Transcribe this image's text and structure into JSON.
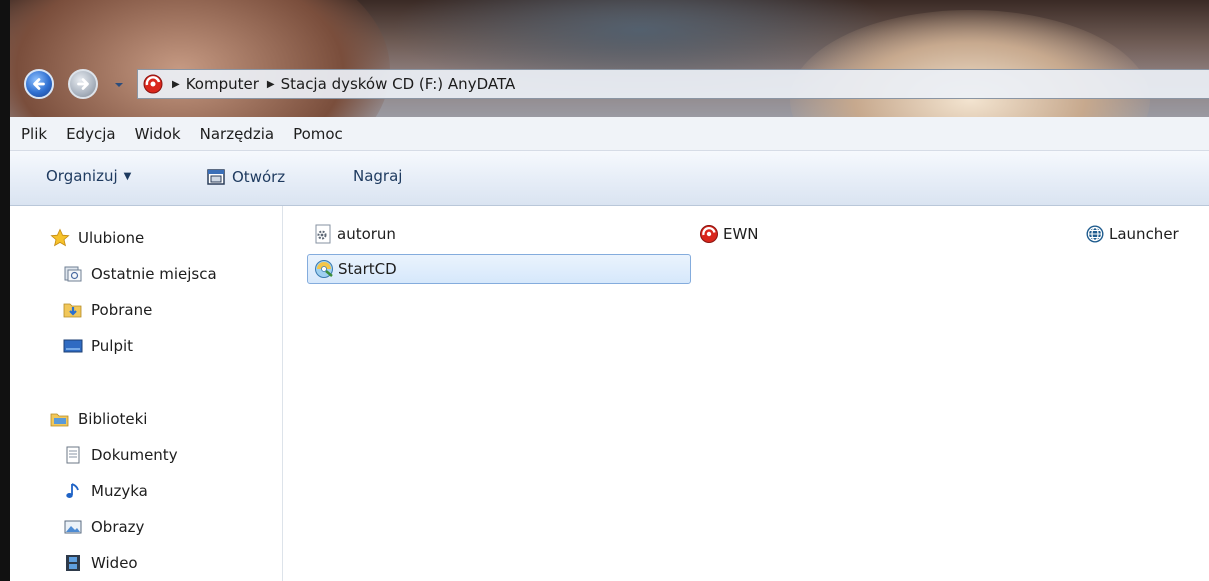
{
  "address": {
    "crumbs": [
      "Komputer",
      "Stacja dysków CD (F:) AnyDATA"
    ]
  },
  "menu": [
    "Plik",
    "Edycja",
    "Widok",
    "Narzędzia",
    "Pomoc"
  ],
  "toolbar": {
    "organize_label": "Organizuj",
    "open_label": "Otwórz",
    "burn_label": "Nagraj"
  },
  "sidebar": {
    "favorites": {
      "title": "Ulubione",
      "items": [
        "Ostatnie miejsca",
        "Pobrane",
        "Pulpit"
      ]
    },
    "libraries": {
      "title": "Biblioteki",
      "items": [
        "Dokumenty",
        "Muzyka",
        "Obrazy",
        "Wideo"
      ]
    }
  },
  "files": [
    {
      "name": "autorun",
      "icon": "settings-file-icon"
    },
    {
      "name": "EWN",
      "icon": "ewn-app-icon"
    },
    {
      "name": "Launcher",
      "icon": "globe-app-icon"
    },
    {
      "name": "StartCD",
      "icon": "startcd-app-icon",
      "selected": true
    }
  ]
}
